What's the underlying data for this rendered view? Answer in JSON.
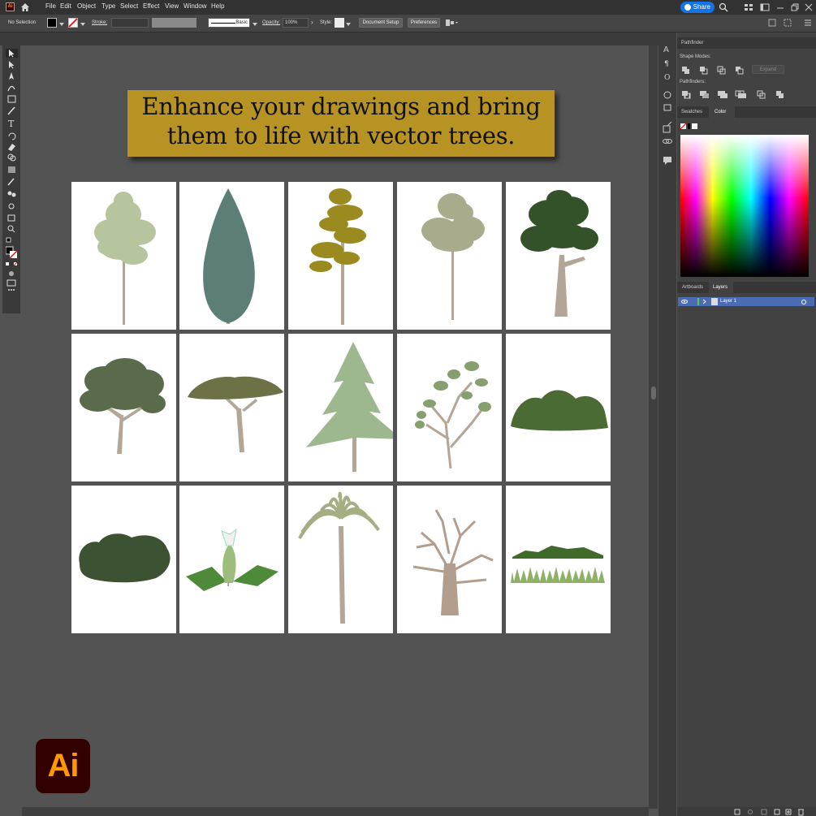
{
  "menu": {
    "items": [
      "File",
      "Edit",
      "Object",
      "Type",
      "Select",
      "Effect",
      "View",
      "Window",
      "Help"
    ],
    "share_label": "Share"
  },
  "control_bar": {
    "selection_label": "No Selection",
    "stroke_label": "Stroke:",
    "brush_label": "Basic",
    "opacity_label": "Opacity:",
    "opacity_value": "100%",
    "style_label": "Style:",
    "document_setup_label": "Document Setup",
    "preferences_label": "Preferences"
  },
  "banner": {
    "line1": "Enhance your drawings and bring",
    "line2": "them to life with vector trees."
  },
  "trees": [
    {
      "name": "broadleaf-pale",
      "color": "#b7c59e"
    },
    {
      "name": "cypress",
      "color": "#5b7f76"
    },
    {
      "name": "pine-ochre",
      "color": "#9a8a1f"
    },
    {
      "name": "birch-sage",
      "color": "#a8ac8c"
    },
    {
      "name": "oak-dark",
      "color": "#34522a"
    },
    {
      "name": "spreading-olive",
      "color": "#5a6b4c"
    },
    {
      "name": "acacia",
      "color": "#6e7046"
    },
    {
      "name": "fir-light",
      "color": "#9db88e"
    },
    {
      "name": "sapling",
      "color": "#85a06e"
    },
    {
      "name": "shrub-green",
      "color": "#4b6b35"
    },
    {
      "name": "hedge-dark",
      "color": "#3d5232"
    },
    {
      "name": "flower-plant",
      "color": "#4f8a3a"
    },
    {
      "name": "palm",
      "color": "#a5ad83"
    },
    {
      "name": "bare-tree",
      "color": "#b39e8e"
    },
    {
      "name": "grass-strip",
      "color": "#5f8a3f"
    }
  ],
  "trunk_color": "#b4a696",
  "panels": {
    "pathfinder_tab": "Pathfinder",
    "shape_modes_label": "Shape Modes:",
    "expand_label": "Expand",
    "pathfinders_label": "Pathfinders:",
    "swatches_tab": "Swatches",
    "color_tab": "Color",
    "artboards_tab": "Artboards",
    "layers_tab": "Layers",
    "layer_name": "Layer 1"
  },
  "logo_text": "Ai",
  "app_badge": "Ai",
  "colors": {
    "banner": "#b79323",
    "canvas": "#535353",
    "accent": "#1473e6",
    "logo_bg": "#330000",
    "logo_fg": "#ff9a00"
  }
}
